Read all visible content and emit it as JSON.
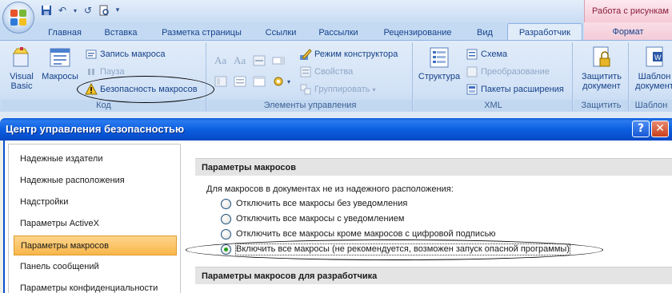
{
  "window": {
    "contextual_tab_header": "Работа с рисункам"
  },
  "ribbon": {
    "tabs": [
      "Главная",
      "Вставка",
      "Разметка страницы",
      "Ссылки",
      "Рассылки",
      "Рецензирование",
      "Вид",
      "Разработчик",
      "Формат"
    ],
    "active_tab": "Разработчик",
    "groups": {
      "code": {
        "label": "Код",
        "visual_basic": "Visual\nBasic",
        "macros": "Макросы",
        "record_macro": "Запись макроса",
        "pause": "Пауза",
        "macro_security": "Безопасность макросов"
      },
      "controls": {
        "label": "Элементы управления",
        "design_mode": "Режим конструктора",
        "properties": "Свойства",
        "group": "Группировать"
      },
      "xml": {
        "label": "XML",
        "structure": "Структура",
        "schema": "Схема",
        "transform": "Преобразование",
        "expansion_packs": "Пакеты расширения"
      },
      "protect": {
        "label": "Защитить",
        "protect_document": "Защитить документ"
      },
      "templates": {
        "label": "Шаблон",
        "document_template": "Шаблон документ"
      }
    }
  },
  "dialog": {
    "title": "Центр управления безопасностью",
    "help_button": "?",
    "close_button": "✕",
    "nav_items": [
      "Надежные издатели",
      "Надежные расположения",
      "Надстройки",
      "Параметры ActiveX",
      "Параметры макросов",
      "Панель сообщений",
      "Параметры конфиденциальности"
    ],
    "selected_nav": "Параметры макросов",
    "macro_settings": {
      "header": "Параметры макросов",
      "description": "Для макросов в документах не из надежного расположения:",
      "options": [
        "Отключить все макросы без уведомления",
        "Отключить все макросы с уведомлением",
        "Отключить все макросы кроме макросов с цифровой подписью",
        "Включить все макросы (не рекомендуется, возможен запуск опасной программы)"
      ],
      "selected_index": 3
    },
    "developer_settings": {
      "header": "Параметры макросов для разработчика"
    }
  },
  "colors": {
    "titlebar": "#0b5fe0",
    "ribbon": "#c4daf3",
    "selected_nav": "#f9b64a",
    "radio_dot": "#21a121"
  }
}
